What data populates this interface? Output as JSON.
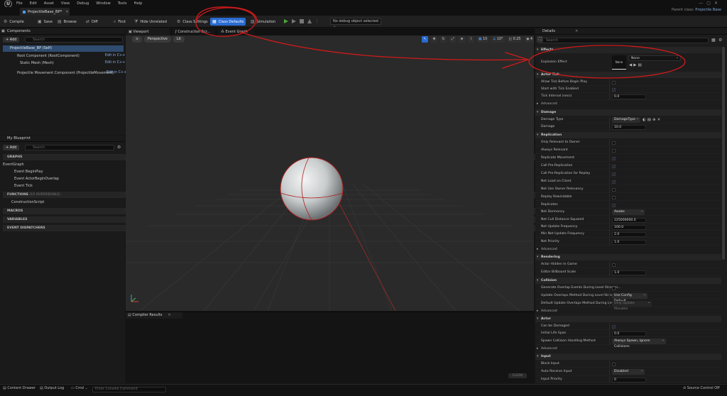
{
  "menu": {
    "items": [
      "File",
      "Edit",
      "Asset",
      "View",
      "Debug",
      "Window",
      "Tools",
      "Help"
    ]
  },
  "window": {
    "parent_class_label": "Parent class:",
    "parent_class_value": "Projectile Base"
  },
  "tab": {
    "title": "ProjectileBase_BP*"
  },
  "toolbar": {
    "compile": "Compile",
    "save": "Save",
    "browse": "Browse",
    "diff": "Diff",
    "find": "Find",
    "hide_unrelated": "Hide Unrelated",
    "class_settings": "Class Settings",
    "class_defaults": "Class Defaults",
    "simulation": "Simulation",
    "debug_object": "No debug object selected"
  },
  "components": {
    "title": "Components",
    "add": "+ Add",
    "search_placeholder": "Search",
    "root": "ProjectileBase_BP (Self)",
    "items": [
      {
        "label": "Root Component (RootComponent)",
        "edit": "Edit in C++"
      },
      {
        "label": "Static Mesh (Mesh)",
        "edit": "Edit in C++"
      },
      {
        "label": "Projectile Movement Component (ProjectileMovement)",
        "edit": "Edit in C++"
      }
    ]
  },
  "blueprint": {
    "title": "My Blueprint",
    "add": "+ Add",
    "search_placeholder": "Search",
    "graphs": "GRAPHS",
    "event_graph": "EventGraph",
    "events": [
      "Event BeginPlay",
      "Event ActorBeginOverlap",
      "Event Tick"
    ],
    "functions": "FUNCTIONS",
    "functions_count": "(15 OVERRIDABLE)",
    "construction": "ConstructionScript",
    "macros": "MACROS",
    "variables": "VARIABLES",
    "dispatchers": "EVENT DISPATCHERS"
  },
  "viewport": {
    "tabs": [
      "Viewport",
      "Construction Scr...",
      "Event Graph"
    ],
    "perspective": "Perspective",
    "lit": "Lit",
    "grid": "10",
    "angle": "10°",
    "scale": "0.25",
    "cam": "4"
  },
  "compiler": {
    "title": "Compiler Results",
    "clear": "CLEAR"
  },
  "details": {
    "title": "Details",
    "search_placeholder": "Search",
    "effects": {
      "header": "Effects",
      "explosion_label": "Explosion Effect",
      "thumb": "None",
      "value": "None"
    },
    "actor_tick": {
      "header": "Actor Tick",
      "rows": [
        "Allow Tick Before Begin Play",
        "Start with Tick Enabled",
        "Tick Interval (secs)"
      ],
      "interval": "0.0",
      "advanced": "Advanced"
    },
    "damage": {
      "header": "Damage",
      "type_label": "Damage Type",
      "type_value": "DamageType",
      "damage_label": "Damage",
      "damage_value": "10.0"
    },
    "replication": {
      "header": "Replication",
      "checks": [
        "Only Relevant to Owner",
        "Always Relevant",
        "Replicate Movement",
        "Call Pre-Replication",
        "Call Pre-Replication for Replay",
        "Net Load on Client",
        "Net Use Owner Relevancy",
        "Replay Rewindable",
        "Replicates"
      ],
      "dormancy_label": "Net Dormancy",
      "dormancy_value": "Awake",
      "cull_label": "Net Cull Distance Squared",
      "cull_value": "225000000.0",
      "freq_label": "Net Update Frequency",
      "freq_value": "100.0",
      "minfreq_label": "Min Net Update Frequency",
      "minfreq_value": "2.0",
      "priority_label": "Net Priority",
      "priority_value": "1.0",
      "advanced": "Advanced"
    },
    "rendering": {
      "header": "Rendering",
      "hidden_label": "Actor Hidden In Game",
      "billboard_label": "Editor Billboard Scale",
      "billboard_value": "1.0"
    },
    "collision": {
      "header": "Collision",
      "overlap_label": "Generate Overlap Events During Level Streami...",
      "update_label": "Update Overlaps Method During Level Streami...",
      "update_value": "Use Config Default",
      "default_label": "Default Update Overlaps Method During Level...",
      "default_value": "Only Update Movable",
      "advanced": "Advanced"
    },
    "actor": {
      "header": "Actor",
      "damaged_label": "Can be Damaged",
      "lifespan_label": "Initial Life Span",
      "lifespan_value": "0.0",
      "spawn_label": "Spawn Collision Handling Method",
      "spawn_value": "Always Spawn, Ignore Collisions",
      "advanced": "Advanced"
    },
    "input": {
      "header": "Input",
      "block_label": "Block Input",
      "receive_label": "Auto Receive Input",
      "receive_value": "Disabled",
      "priority_label": "Input Priority",
      "priority_value": "0"
    }
  },
  "status": {
    "content_drawer": "Content Drawer",
    "output_log": "Output Log",
    "cmd": "Cmd",
    "cmd_placeholder": "Enter Console Command",
    "source_control": "Source Control Off"
  },
  "colors": {
    "accent": "#2a6cd1",
    "annotation": "#d11a1a",
    "play": "#4caa3a",
    "link": "#8ab0e0"
  }
}
